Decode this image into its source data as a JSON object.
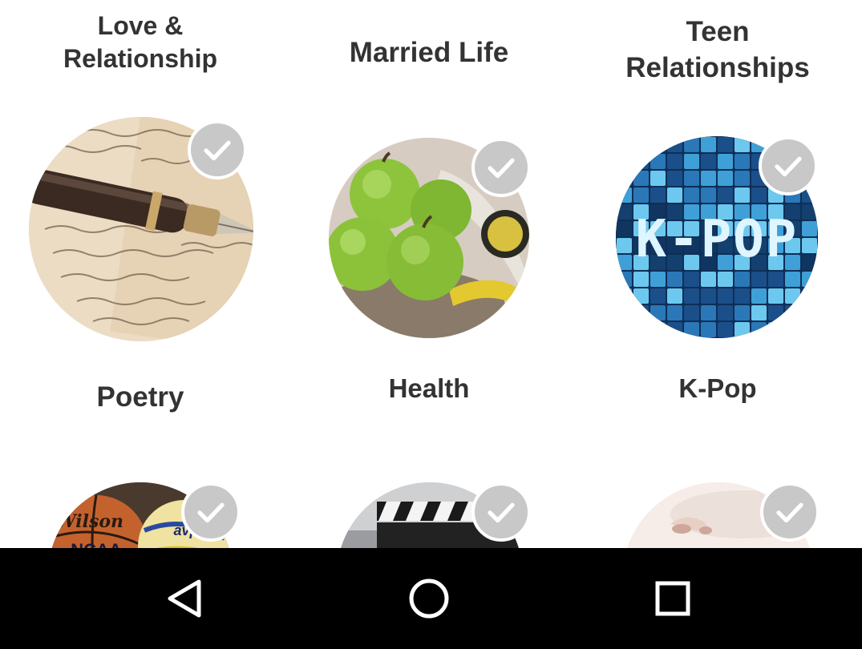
{
  "categories": {
    "row1": [
      {
        "lines": [
          "Love &",
          "Relationship"
        ]
      },
      {
        "lines": [
          "Married Life"
        ]
      },
      {
        "lines": [
          "Teen",
          "Relationships"
        ]
      }
    ],
    "row2": [
      {
        "label": "Poetry",
        "image": "fountain-pen-on-letters",
        "selected_icon": "check-icon"
      },
      {
        "label": "Health",
        "image": "green-apples-measuring-tape",
        "selected_icon": "check-icon"
      },
      {
        "label": "K-Pop",
        "image": "kpop-mosaic",
        "image_text": "K-POP",
        "selected_icon": "check-icon"
      }
    ],
    "row3": [
      {
        "image": "sports-balls",
        "image_text_1": "Wilson",
        "image_text_2": "NCAA",
        "image_text_3": "avp",
        "selected_icon": "check-icon"
      },
      {
        "image": "film-clapperboard",
        "selected_icon": "check-icon"
      },
      {
        "image": "face-closeup",
        "selected_icon": "check-icon"
      }
    ]
  },
  "navigation": {
    "back": "back-icon",
    "home": "home-icon",
    "recents": "recents-icon"
  },
  "colors": {
    "text": "#333333",
    "check_badge": "#c8c8c8",
    "nav_bar": "#000000"
  }
}
